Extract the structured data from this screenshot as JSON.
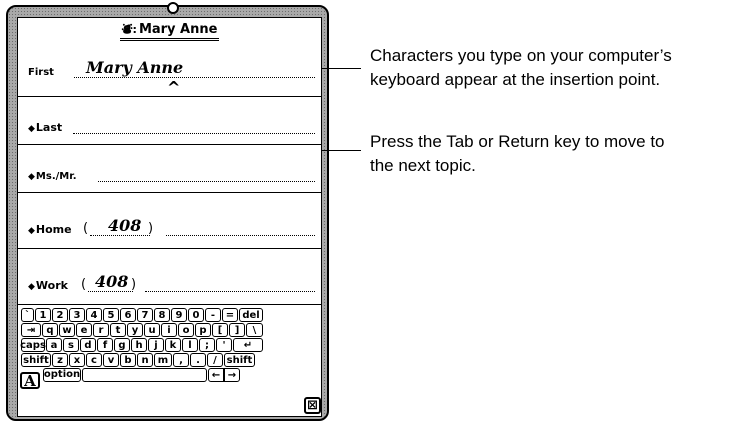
{
  "card": {
    "title": "Mary Anne",
    "title_icon": "person-card-icon"
  },
  "fields": [
    {
      "label": "First",
      "value": "Mary Anne",
      "has_diamond": false
    },
    {
      "label": "Last",
      "value": "",
      "has_diamond": true
    },
    {
      "label": "Ms./Mr.",
      "value": "",
      "has_diamond": true
    },
    {
      "label": "Home",
      "value": "408",
      "has_diamond": true
    },
    {
      "label": "Work",
      "value": "408",
      "has_diamond": true
    }
  ],
  "keyboard": {
    "row1": [
      "`",
      "1",
      "2",
      "3",
      "4",
      "5",
      "6",
      "7",
      "8",
      "9",
      "0",
      "-",
      "=",
      "del"
    ],
    "row2": [
      "⇥",
      "q",
      "w",
      "e",
      "r",
      "t",
      "y",
      "u",
      "i",
      "o",
      "p",
      "[",
      "]",
      "\\"
    ],
    "row3": [
      "caps",
      "a",
      "s",
      "d",
      "f",
      "g",
      "h",
      "j",
      "k",
      "l",
      ";",
      "'",
      "↵"
    ],
    "row4": [
      "shift",
      "z",
      "x",
      "c",
      "v",
      "b",
      "n",
      "m",
      ",",
      ".",
      "/",
      "shift"
    ],
    "row5": [
      "option",
      "",
      "←",
      "→"
    ],
    "a_button": "A",
    "close_button": "⊠"
  },
  "callouts": {
    "insertion_line1": "Characters you type on your computer’s",
    "insertion_line2": "keyboard appear at the insertion point.",
    "tab_line1": "Press the Tab or Return key to move to",
    "tab_line2": "the next topic."
  }
}
